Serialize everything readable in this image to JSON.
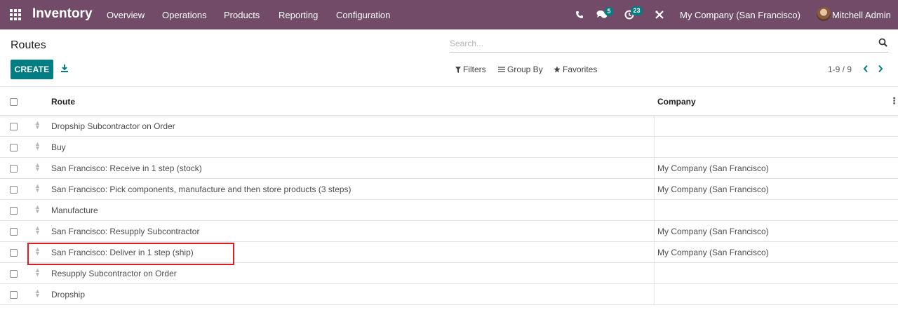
{
  "navbar": {
    "app_title": "Inventory",
    "menu": [
      "Overview",
      "Operations",
      "Products",
      "Reporting",
      "Configuration"
    ],
    "messages_count": "5",
    "activities_count": "23",
    "company": "My Company (San Francisco)",
    "user": "Mitchell Admin",
    "bg_color": "#714b67"
  },
  "control_panel": {
    "title": "Routes",
    "search_placeholder": "Search...",
    "create_label": "CREATE",
    "filters_label": "Filters",
    "group_by_label": "Group By",
    "favorites_label": "Favorites",
    "pager": "1-9 / 9",
    "accent_color": "#017e84"
  },
  "table": {
    "headers": {
      "route": "Route",
      "company": "Company"
    },
    "rows": [
      {
        "route": "Dropship Subcontractor on Order",
        "company": ""
      },
      {
        "route": "Buy",
        "company": ""
      },
      {
        "route": "San Francisco: Receive in 1 step (stock)",
        "company": "My Company (San Francisco)"
      },
      {
        "route": "San Francisco: Pick components, manufacture and then store products (3 steps)",
        "company": "My Company (San Francisco)"
      },
      {
        "route": "Manufacture",
        "company": ""
      },
      {
        "route": "San Francisco: Resupply Subcontractor",
        "company": "My Company (San Francisco)"
      },
      {
        "route": "San Francisco: Deliver in 1 step (ship)",
        "company": "My Company (San Francisco)"
      },
      {
        "route": "Resupply Subcontractor on Order",
        "company": ""
      },
      {
        "route": "Dropship",
        "company": ""
      }
    ],
    "highlighted_row_index": 6,
    "highlight_color": "#e01b24"
  }
}
